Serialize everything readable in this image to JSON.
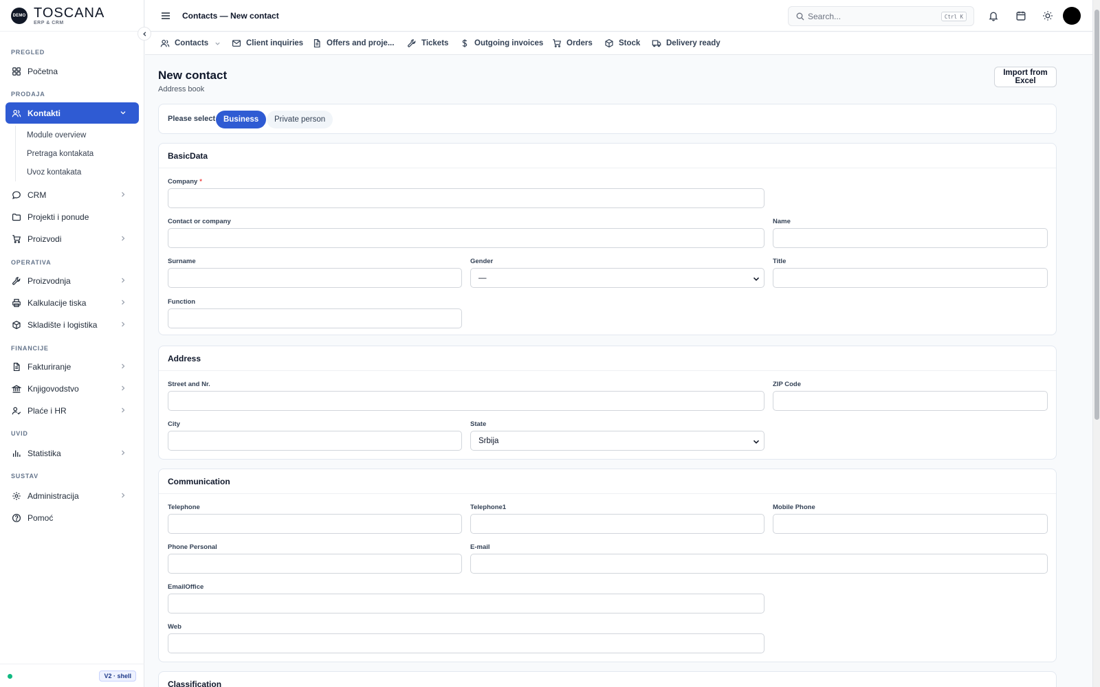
{
  "brand": {
    "badge": "DEMO",
    "name": "TOSCANA",
    "sub": "ERP & CRM"
  },
  "sidebar": {
    "sections": {
      "pregled": "PREGLED",
      "prodaja": "PRODAJA",
      "operativa": "OPERATIVA",
      "financije": "FINANCIJE",
      "uvid": "UVID",
      "sustav": "SUSTAV"
    },
    "items": {
      "pocetna": "Početna",
      "kontakti": "Kontakti",
      "crm": "CRM",
      "projekti": "Projekti i ponude",
      "proizvodi": "Proizvodi",
      "proizvodnja": "Proizvodnja",
      "kalkulacije": "Kalkulacije tiska",
      "skladiste": "Skladište i logistika",
      "fakturiranje": "Fakturiranje",
      "knjigovodstvo": "Knjigovodstvo",
      "place": "Plaće i HR",
      "statistika": "Statistika",
      "administracija": "Administracija",
      "pomoc": "Pomoć"
    },
    "submenu": [
      "Module overview",
      "Pretraga kontakata",
      "Uvoz kontakata"
    ],
    "version": "V2 · shell",
    "status_color": "#10b981"
  },
  "topbar": {
    "title": "Contacts — New contact",
    "search_placeholder": "Search...",
    "search_shortcut": "Ctrl K"
  },
  "tabs": [
    "Contacts",
    "Client inquiries",
    "Offers and proje...",
    "Tickets",
    "Outgoing invoices",
    "Orders",
    "Stock",
    "Delivery ready"
  ],
  "page": {
    "title": "New contact",
    "subtitle": "Address book",
    "import_label": "Import from Excel"
  },
  "contact_type": {
    "label": "Please select",
    "options": [
      "Business",
      "Private person"
    ],
    "selected": "Business"
  },
  "basic": {
    "title": "BasicData",
    "company": "Company",
    "contact_or_company": "Contact or company",
    "name": "Name",
    "surname": "Surname",
    "gender": "Gender",
    "gender_value": "—",
    "title_label": "Title",
    "function": "Function"
  },
  "address": {
    "title": "Address",
    "street": "Street and Nr.",
    "zip": "ZIP Code",
    "city": "City",
    "state": "State",
    "state_value": "Srbija"
  },
  "communication": {
    "title": "Communication",
    "telephone": "Telephone",
    "telephone1": "Telephone1",
    "mobile": "Mobile Phone",
    "phone_personal": "Phone Personal",
    "email": "E-mail",
    "email_office": "EmailOffice",
    "web": "Web"
  },
  "classification": {
    "title": "Classification"
  },
  "colors": {
    "accent": "#2f5bd3",
    "required": "#ef4444"
  }
}
